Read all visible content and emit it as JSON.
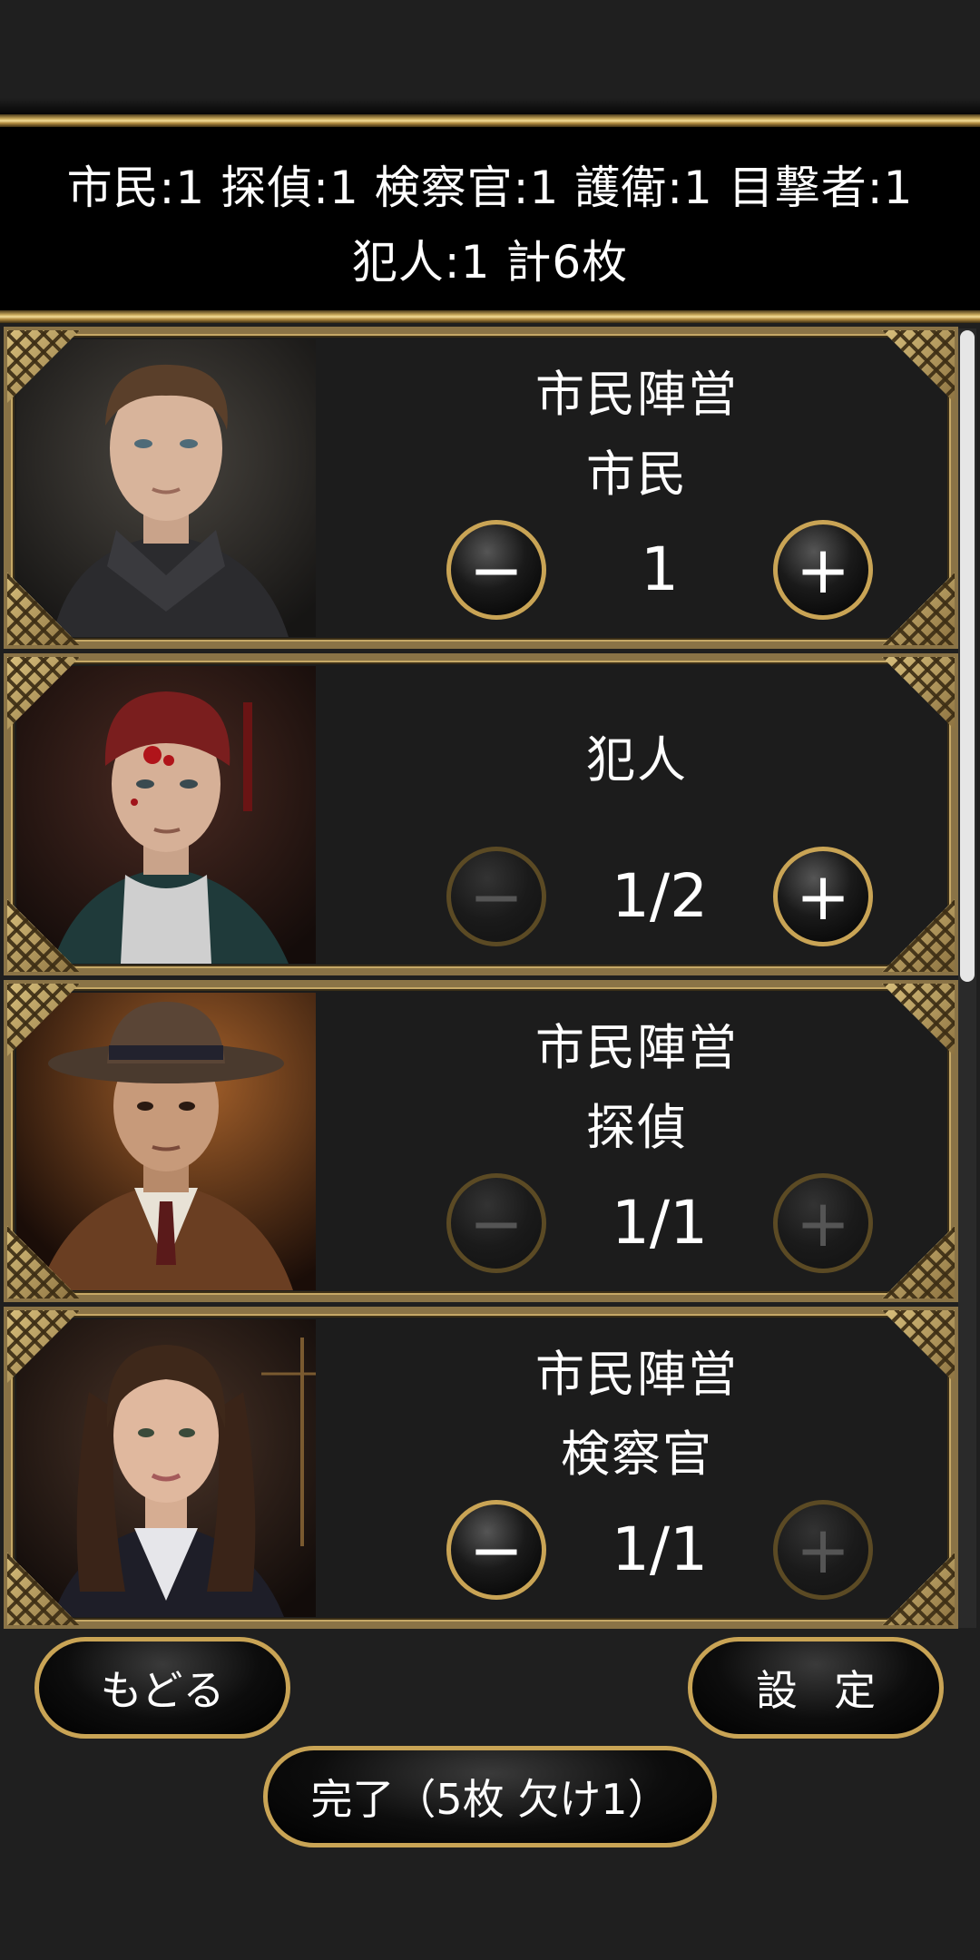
{
  "summary": {
    "line1": "市民:1 探偵:1 検察官:1 護衛:1 目撃者:1",
    "line2": "犯人:1 計6枚"
  },
  "cards": [
    {
      "faction": "市民陣営",
      "role": "市民",
      "count": "1",
      "minus_enabled": true,
      "plus_enabled": true
    },
    {
      "faction": "",
      "role": "犯人",
      "count": "1/2",
      "minus_enabled": false,
      "plus_enabled": true
    },
    {
      "faction": "市民陣営",
      "role": "探偵",
      "count": "1/1",
      "minus_enabled": false,
      "plus_enabled": false
    },
    {
      "faction": "市民陣営",
      "role": "検察官",
      "count": "1/1",
      "minus_enabled": true,
      "plus_enabled": false
    }
  ],
  "stepper": {
    "minus_symbol": "−",
    "plus_symbol": "+"
  },
  "footer": {
    "back_label": "もどる",
    "settings_label": "設定",
    "done_label": "完了（5枚 欠け1）"
  },
  "colors": {
    "accent_gold": "#c9a455",
    "background": "#1f1f1f"
  }
}
